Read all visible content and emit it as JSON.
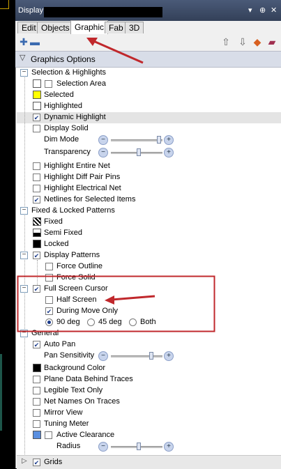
{
  "window": {
    "title": "Display",
    "controls": [
      "▾",
      "⊕",
      "✕"
    ]
  },
  "tabs": [
    {
      "label": "Edit",
      "active": false
    },
    {
      "label": "Objects",
      "active": false
    },
    {
      "label": "Graphic",
      "active": true
    },
    {
      "label": "Fab",
      "active": false
    },
    {
      "label": "3D",
      "active": false
    }
  ],
  "section_header": {
    "label": "Graphics Options"
  },
  "groups": {
    "selection": {
      "label": "Selection & Highlights",
      "items": [
        {
          "label": "Selection Area",
          "checked": false,
          "swatch": "#ffffff"
        },
        {
          "label": "Selected",
          "swatch": "#ffff00"
        },
        {
          "label": "Highlighted",
          "swatch": "#ffffff"
        },
        {
          "label": "Dynamic Highlight",
          "checked": true
        },
        {
          "label": "Display Solid",
          "checked": false
        }
      ],
      "dim_mode": {
        "label": "Dim Mode",
        "value": 1.0
      },
      "transparency": {
        "label": "Transparency",
        "value": 0.5
      },
      "more": [
        {
          "label": "Highlight Entire Net",
          "checked": false
        },
        {
          "label": "Highlight Diff Pair Pins",
          "checked": false
        },
        {
          "label": "Highlight Electrical Net",
          "checked": false
        },
        {
          "label": "Netlines for Selected Items",
          "checked": true
        }
      ]
    },
    "fixed": {
      "label": "Fixed & Locked Patterns",
      "items": [
        {
          "label": "Fixed"
        },
        {
          "label": "Semi Fixed"
        },
        {
          "label": "Locked"
        }
      ]
    },
    "display_patterns": {
      "label": "Display Patterns",
      "checked": true,
      "items": [
        {
          "label": "Force Outline",
          "checked": false
        },
        {
          "label": "Force Solid",
          "checked": false
        }
      ]
    },
    "cursor": {
      "label": "Full Screen Cursor",
      "checked": true,
      "items": [
        {
          "label": "Half Screen",
          "checked": false
        },
        {
          "label": "During Move Only",
          "checked": true
        }
      ],
      "angles": [
        {
          "label": "90 deg",
          "selected": true
        },
        {
          "label": "45 deg",
          "selected": false
        },
        {
          "label": "Both",
          "selected": false
        }
      ]
    },
    "general": {
      "label": "General",
      "auto_pan": {
        "label": "Auto Pan",
        "checked": true
      },
      "pan_sensitivity": {
        "label": "Pan Sensitivity",
        "value": 0.8
      },
      "background": {
        "label": "Background Color",
        "swatch": "#000000"
      },
      "items": [
        {
          "label": "Plane Data Behind Traces",
          "checked": false
        },
        {
          "label": "Legible Text Only",
          "checked": false
        },
        {
          "label": "Net Names On Traces",
          "checked": false
        },
        {
          "label": "Mirror View",
          "checked": false
        },
        {
          "label": "Tuning Meter",
          "checked": false
        }
      ],
      "clearance": {
        "label": "Active Clearance",
        "checked": false,
        "swatch": "#5a8fe0"
      },
      "radius": {
        "label": "Radius",
        "value": 0.5
      }
    },
    "grids": {
      "label": "Grids",
      "checked": true
    }
  },
  "colors": {
    "annotation": "#c0282c",
    "selected": "#ffff00",
    "highlight_row": "#e4e4e4"
  }
}
